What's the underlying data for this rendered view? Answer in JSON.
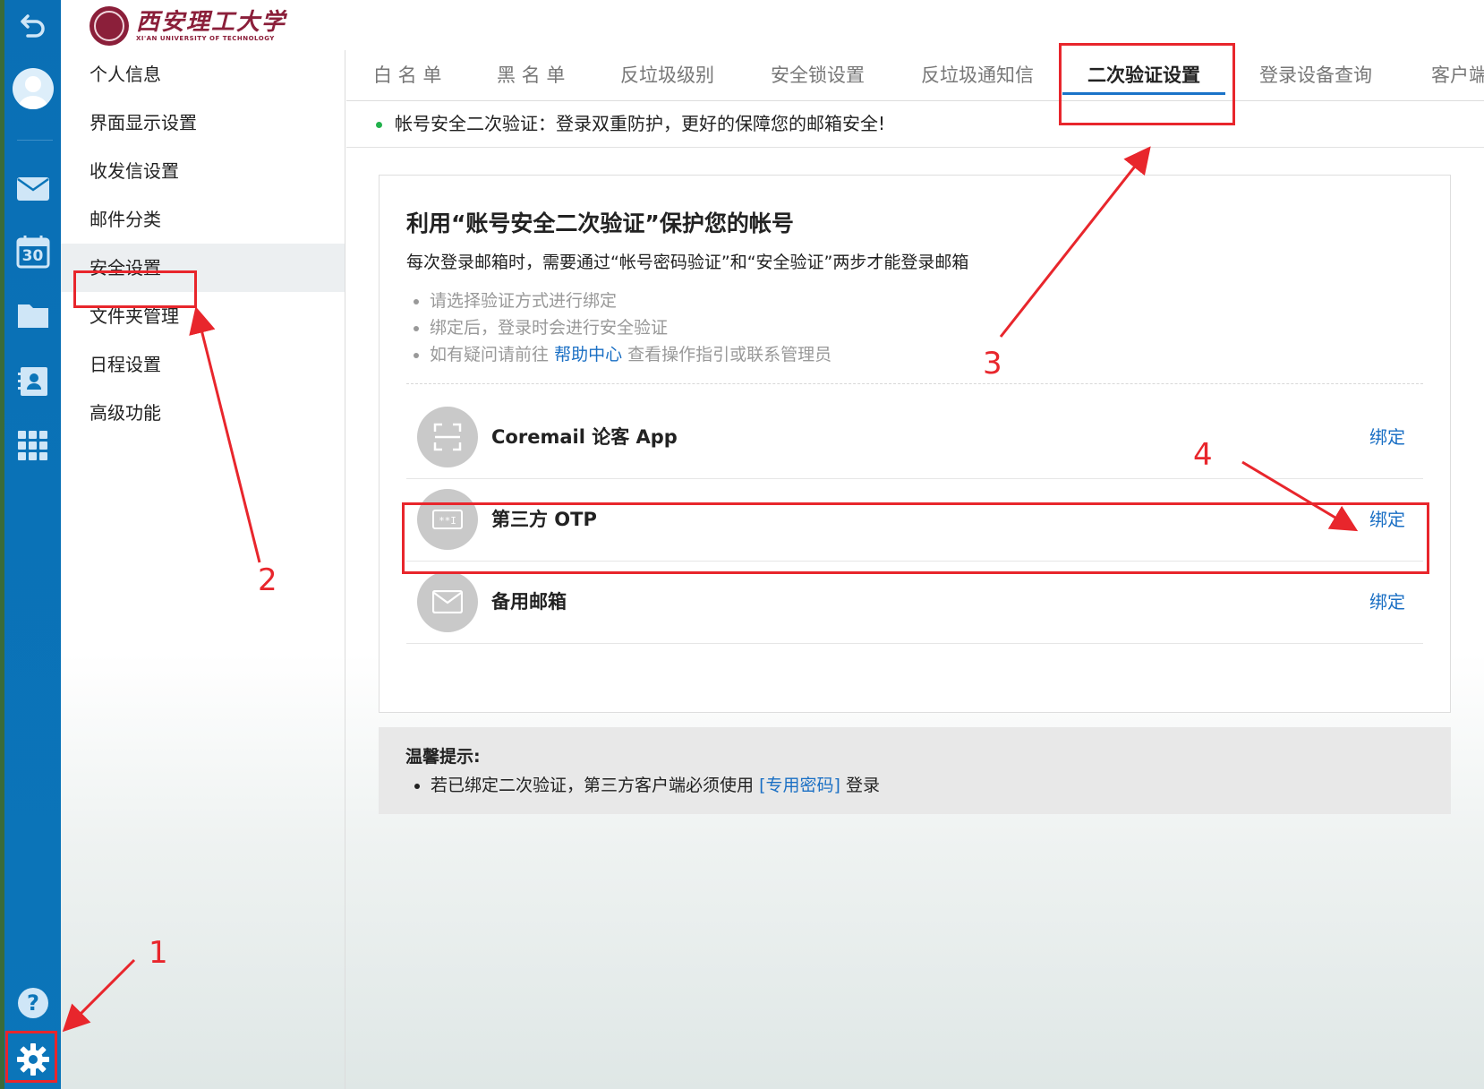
{
  "logo": {
    "name_cn": "西安理工大学",
    "name_en": "XI'AN UNIVERSITY OF TECHNOLOGY"
  },
  "rail": {
    "icons": [
      "back-icon",
      "avatar-icon",
      "mail-icon",
      "calendar-icon",
      "folder-icon",
      "contacts-icon",
      "apps-icon",
      "help-icon",
      "gear-icon"
    ],
    "calendar_day": "30"
  },
  "sidebar": {
    "items": [
      {
        "label": "个人信息"
      },
      {
        "label": "界面显示设置"
      },
      {
        "label": "收发信设置"
      },
      {
        "label": "邮件分类"
      },
      {
        "label": "安全设置"
      },
      {
        "label": "文件夹管理"
      },
      {
        "label": "日程设置"
      },
      {
        "label": "高级功能"
      }
    ],
    "active": "安全设置"
  },
  "tabs": [
    {
      "label": "白 名 单"
    },
    {
      "label": "黑 名 单"
    },
    {
      "label": "反垃圾级别"
    },
    {
      "label": "安全锁设置"
    },
    {
      "label": "反垃圾通知信"
    },
    {
      "label": "二次验证设置"
    },
    {
      "label": "登录设备查询"
    },
    {
      "label": "客户端"
    }
  ],
  "active_tab": "二次验证设置",
  "notice": "帐号安全二次验证：登录双重防护，更好的保障您的邮箱安全!",
  "card": {
    "title": "利用“账号安全二次验证”保护您的帐号",
    "description": "每次登录邮箱时，需要通过“帐号密码验证”和“安全验证”两步才能登录邮箱",
    "tips": [
      "请选择验证方式进行绑定",
      "绑定后，登录时会进行安全验证"
    ],
    "tip3_prefix": "如有疑问请前往",
    "tip3_link": "帮助中心",
    "tip3_suffix": "查看操作指引或联系管理员",
    "methods": [
      {
        "name": "Coremail 论客 App",
        "action": "绑定",
        "icon": "scan-icon"
      },
      {
        "name": "第三方 OTP",
        "action": "绑定",
        "icon": "otp-icon"
      },
      {
        "name": "备用邮箱",
        "action": "绑定",
        "icon": "envelope-icon"
      }
    ]
  },
  "warm_tip": {
    "title": "温馨提示:",
    "text_prefix": "若已绑定二次验证，第三方客户端必须使用",
    "link": "[专用密码]",
    "text_suffix": "登录"
  },
  "annotations": [
    "1",
    "2",
    "3",
    "4"
  ],
  "colors": {
    "rail": "#0b75b9",
    "accent": "#1a73c8",
    "link": "#1a6fc4",
    "annotation": "#e8262c",
    "dot": "#22b14c"
  }
}
